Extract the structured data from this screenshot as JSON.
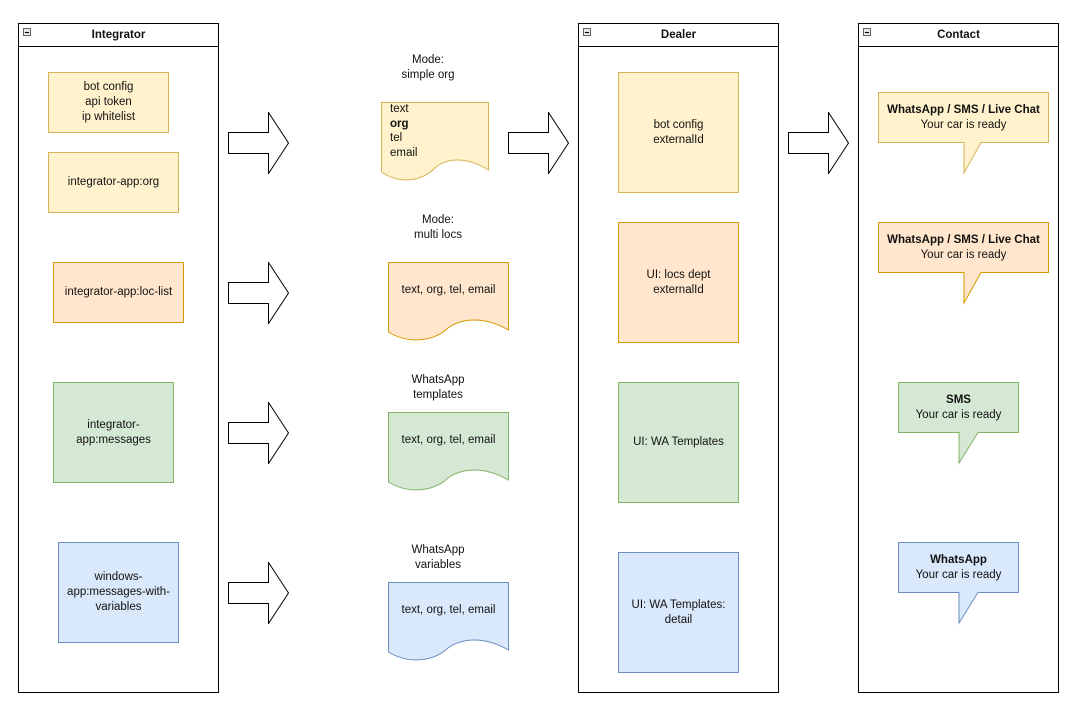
{
  "colors": {
    "yellow_fill": "#fff2cc",
    "yellow_stroke": "#d6b656",
    "orange_fill": "#ffe6cc",
    "orange_stroke": "#d79b00",
    "green_fill": "#d5e8d4",
    "green_stroke": "#82b366",
    "blue_fill": "#dae8fc",
    "blue_stroke": "#6c8ebf"
  },
  "pools": {
    "integrator": {
      "title": "Integrator",
      "items": [
        {
          "lines": [
            "bot config",
            "api token",
            "ip whitelist"
          ],
          "color": "yellow"
        },
        {
          "lines": [
            "integrator-app:org"
          ],
          "color": "yellow"
        },
        {
          "lines": [
            "integrator-app:loc-list"
          ],
          "color": "orange"
        },
        {
          "lines": [
            "integrator-",
            "app:messages"
          ],
          "color": "green"
        },
        {
          "lines": [
            "windows-",
            "app:messages-with-",
            "variables"
          ],
          "color": "blue"
        }
      ]
    },
    "dealer": {
      "title": "Dealer",
      "items": [
        {
          "lines": [
            "bot config",
            "externalId"
          ],
          "color": "yellow"
        },
        {
          "lines": [
            "UI: locs dept",
            "externalId"
          ],
          "color": "orange"
        },
        {
          "lines": [
            "UI: WA Templates"
          ],
          "color": "green"
        },
        {
          "lines": [
            "UI: WA Templates:",
            "detail"
          ],
          "color": "blue"
        }
      ]
    },
    "contact": {
      "title": "Contact",
      "bubbles": [
        {
          "title": "WhatsApp / SMS / Live Chat",
          "message": "Your car is ready",
          "color": "yellow"
        },
        {
          "title": "WhatsApp / SMS / Live Chat",
          "message": "Your car is ready",
          "color": "orange"
        },
        {
          "title": "SMS",
          "message": "Your car is ready",
          "color": "green"
        },
        {
          "title": "WhatsApp",
          "message": "Your car is ready",
          "color": "blue"
        }
      ]
    }
  },
  "modes": [
    {
      "caption": [
        "Mode:",
        "simple org"
      ],
      "fields": [
        "text",
        "org",
        "tel",
        "email"
      ],
      "bold_field": "org",
      "color": "yellow"
    },
    {
      "caption": [
        "Mode:",
        "multi locs"
      ],
      "fields_text": "text, org, tel, email",
      "color": "orange"
    },
    {
      "caption": [
        "WhatsApp",
        "templates"
      ],
      "fields_text": "text, org, tel, email",
      "color": "green"
    },
    {
      "caption": [
        "WhatsApp",
        "variables"
      ],
      "fields_text": "text, org, tel, email",
      "color": "blue"
    }
  ],
  "arrows": [
    "arrow-right-icon",
    "arrow-right-icon",
    "arrow-right-icon",
    "arrow-right-icon",
    "arrow-right-icon",
    "arrow-right-icon"
  ]
}
